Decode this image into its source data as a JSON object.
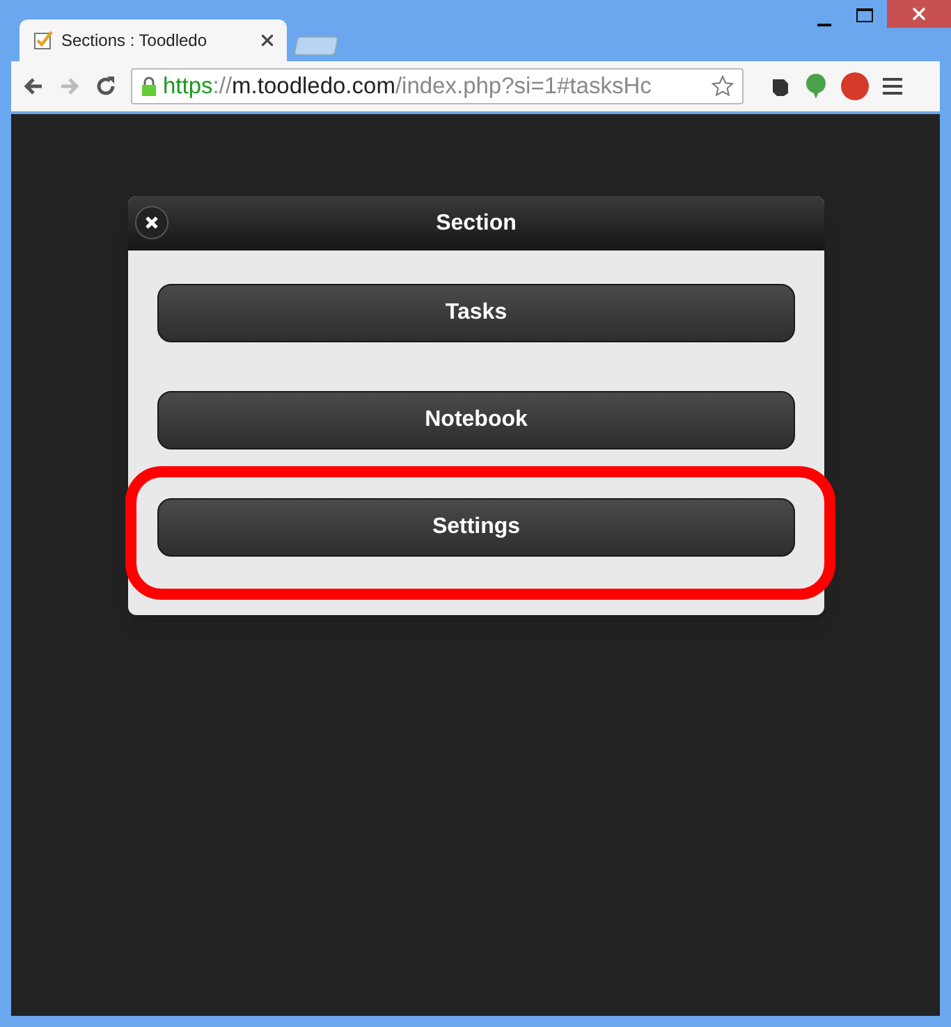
{
  "browser": {
    "tab_title": "Sections : Toodledo",
    "url": {
      "scheme": "https",
      "separator": "://",
      "host": "m.toodledo.com",
      "path": "/index.php?si=1#tasksHc"
    }
  },
  "dialog": {
    "title": "Section",
    "buttons": [
      {
        "label": "Tasks",
        "highlighted": false
      },
      {
        "label": "Notebook",
        "highlighted": false
      },
      {
        "label": "Settings",
        "highlighted": true
      }
    ]
  }
}
